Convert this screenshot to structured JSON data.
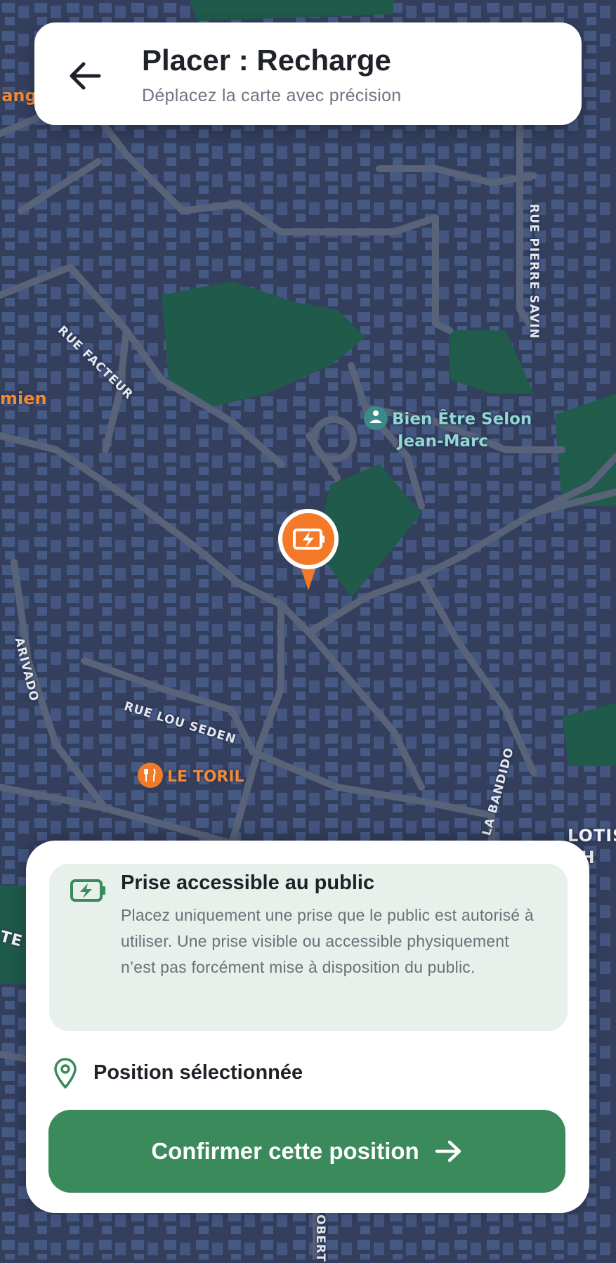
{
  "header": {
    "back_icon": "arrow-left-icon",
    "title": "Placer : Recharge",
    "subtitle": "Déplacez la carte avec précision"
  },
  "map": {
    "streets": [
      "RUE FACTEUR",
      "RUE PIERRE SAVIN",
      "RUE LOU SEDEN",
      "ARIVADO",
      "E LA BANDIDO",
      "OBERT"
    ],
    "places": [
      "Bien Être Selon",
      "Jean-Marc",
      "LE TORIL",
      "mien",
      "lang",
      "LOTIS",
      "CH",
      "TE"
    ],
    "pin_icon": "charging-station-icon",
    "pin_color": "#f47a2a"
  },
  "sheet": {
    "notice": {
      "icon": "battery-charging-icon",
      "title": "Prise accessible au public",
      "body": "Placez uniquement une prise que le public est autorisé à utiliser. Une prise visible ou accessible physiquement n’est pas forcément mise à disposition du public."
    },
    "position": {
      "icon": "location-pin-icon",
      "label": "Position sélectionnée"
    },
    "confirm": {
      "label": "Confirmer cette position",
      "icon": "arrow-right-icon"
    }
  },
  "colors": {
    "accent": "#3a8a5b",
    "notice_bg": "#e7f0ea",
    "map_bg": "#333e5c",
    "park": "#1f5a4a"
  }
}
